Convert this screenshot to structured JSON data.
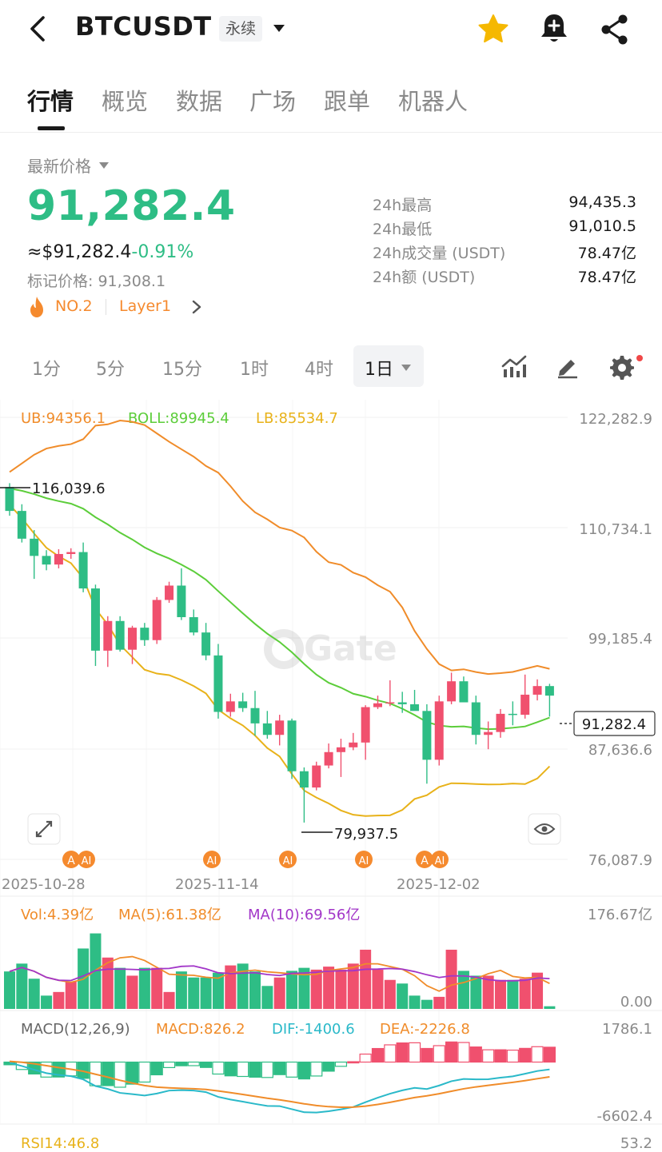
{
  "header": {
    "title": "BTCUSDT",
    "contract_type": "永续"
  },
  "tabs": [
    {
      "label": "行情",
      "active": true
    },
    {
      "label": "概览",
      "active": false
    },
    {
      "label": "数据",
      "active": false
    },
    {
      "label": "广场",
      "active": false
    },
    {
      "label": "跟单",
      "active": false
    },
    {
      "label": "机器人",
      "active": false
    }
  ],
  "price": {
    "label": "最新价格",
    "last": "91,282.4",
    "usd": "≈$91,282.4",
    "change": "-0.91%",
    "mark_label": "标记价格: ",
    "mark_value": "91,308.1",
    "rank": "NO.2",
    "category": "Layer1",
    "color_up": "#f0506e",
    "color_down": "#2ebd85"
  },
  "stats": [
    {
      "label": "24h最高",
      "value": "94,435.3"
    },
    {
      "label": "24h最低",
      "value": "91,010.5"
    },
    {
      "label": "24h成交量 (USDT)",
      "value": "78.47亿"
    },
    {
      "label": "24h额 (USDT)",
      "value": "78.47亿"
    }
  ],
  "intervals": [
    {
      "label": "1分",
      "active": false
    },
    {
      "label": "5分",
      "active": false
    },
    {
      "label": "15分",
      "active": false
    },
    {
      "label": "1时",
      "active": false
    },
    {
      "label": "4时",
      "active": false
    },
    {
      "label": "1日",
      "active": true
    }
  ],
  "chart": {
    "watermark": "Gate",
    "boll_legend": [
      {
        "text": "UB:94356.1",
        "color": "#f08c2a"
      },
      {
        "text": "BOLL:89945.4",
        "color": "#5ccd3a"
      },
      {
        "text": "LB:85534.7",
        "color": "#e8b21a"
      }
    ],
    "price_axis": [
      "122,282.9",
      "110,734.1",
      "99,185.4",
      "87,636.6",
      "76,087.9"
    ],
    "price_range": [
      76087.9,
      122282.9
    ],
    "high_mark": "116,039.6",
    "low_mark": "79,937.5",
    "last_price_tag": "91,282.4",
    "date_labels": [
      "2025-10-28",
      "2025-11-14",
      "2025-12-02"
    ],
    "ai_badges": [
      "A",
      "AI",
      "AI",
      "AI",
      "AI",
      "A",
      "AI"
    ],
    "vol_legend": [
      {
        "text": "Vol:4.39亿",
        "color": "#f08c2a"
      },
      {
        "text": "MA(5):61.38亿",
        "color": "#f08c2a"
      },
      {
        "text": "MA(10):69.56亿",
        "color": "#a236c8"
      }
    ],
    "vol_axis": [
      "176.67亿",
      "0.00"
    ],
    "macd_legend": [
      {
        "text": "MACD(12,26,9)",
        "color": "#666666"
      },
      {
        "text": "MACD:826.2",
        "color": "#f08c2a"
      },
      {
        "text": "DIF:-1400.6",
        "color": "#2ab9c9"
      },
      {
        "text": "DEA:-2226.8",
        "color": "#f08c2a"
      }
    ],
    "macd_axis": [
      "1786.1",
      "-6602.4"
    ],
    "rsi_legend": "RSI14:46.8",
    "rsi_axis": "53.2"
  },
  "chart_data": {
    "type": "candlestick",
    "ylim": [
      76087.9,
      122282.9
    ],
    "candles": [
      [
        115000,
        115400,
        112000,
        112500
      ],
      [
        112500,
        113200,
        109200,
        109600
      ],
      [
        109600,
        110500,
        105400,
        107800
      ],
      [
        107800,
        108400,
        106300,
        106900
      ],
      [
        106900,
        108500,
        106500,
        108000
      ],
      [
        108000,
        108600,
        107500,
        108200
      ],
      [
        108200,
        109200,
        104000,
        104400
      ],
      [
        104400,
        104800,
        96300,
        97900
      ],
      [
        97900,
        101500,
        96200,
        101000
      ],
      [
        101000,
        101500,
        97800,
        98000
      ],
      [
        98000,
        100500,
        96500,
        100300
      ],
      [
        100300,
        100800,
        98400,
        99000
      ],
      [
        99000,
        103500,
        98600,
        103200
      ],
      [
        103200,
        105100,
        102900,
        104700
      ],
      [
        104700,
        106500,
        101100,
        101400
      ],
      [
        101400,
        102200,
        99500,
        99800
      ],
      [
        99800,
        100800,
        96900,
        97400
      ],
      [
        97400,
        98600,
        90800,
        91500
      ],
      [
        91500,
        93400,
        91000,
        92600
      ],
      [
        92600,
        93500,
        91500,
        91900
      ],
      [
        91900,
        93700,
        89000,
        90300
      ],
      [
        90300,
        91600,
        88700,
        89100
      ],
      [
        89100,
        91200,
        88000,
        90600
      ],
      [
        90600,
        90800,
        84500,
        85300
      ],
      [
        85300,
        85700,
        79937.5,
        83600
      ],
      [
        83600,
        86300,
        83300,
        85900
      ],
      [
        85900,
        88200,
        85600,
        87300
      ],
      [
        87300,
        88700,
        84700,
        87800
      ],
      [
        87800,
        89300,
        87500,
        88300
      ],
      [
        88300,
        92200,
        86500,
        92000
      ],
      [
        92000,
        93200,
        91800,
        92400
      ],
      [
        92400,
        94800,
        92100,
        92500
      ],
      [
        92500,
        93600,
        91400,
        92300
      ],
      [
        92300,
        93800,
        91700,
        91600
      ],
      [
        91600,
        92300,
        84000,
        86500
      ],
      [
        86500,
        93200,
        85900,
        92600
      ],
      [
        92600,
        95600,
        92300,
        94700
      ],
      [
        94700,
        95200,
        93300,
        92500
      ],
      [
        92500,
        93200,
        88100,
        89100
      ],
      [
        89100,
        90500,
        87600,
        89400
      ],
      [
        89400,
        91800,
        88800,
        91300
      ],
      [
        91300,
        92600,
        90100,
        91200
      ],
      [
        91200,
        95400,
        90800,
        93300
      ],
      [
        93300,
        94900,
        92700,
        94200
      ],
      [
        94200,
        94435.3,
        91010.5,
        93200
      ]
    ],
    "volumes": [
      62,
      75,
      50,
      22,
      28,
      45,
      100,
      125,
      85,
      68,
      55,
      68,
      68,
      28,
      62,
      52,
      52,
      60,
      72,
      75,
      62,
      38,
      52,
      63,
      68,
      65,
      70,
      65,
      75,
      98,
      65,
      48,
      42,
      22,
      15,
      20,
      98,
      63,
      55,
      55,
      48,
      48,
      50,
      60,
      4.39
    ]
  }
}
